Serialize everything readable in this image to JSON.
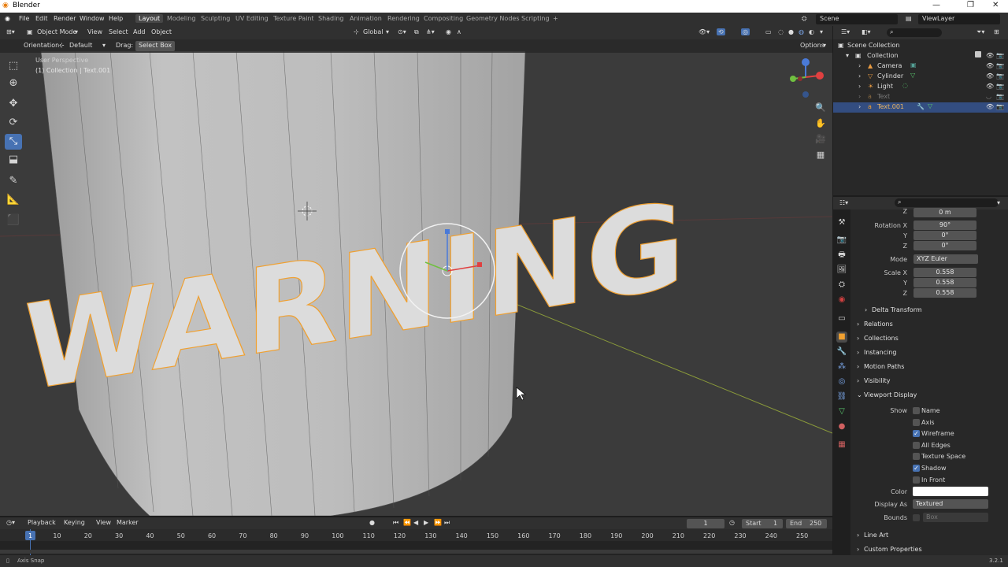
{
  "window": {
    "title": "Blender",
    "min": "—",
    "max": "❐",
    "close": "✕"
  },
  "menus": [
    "File",
    "Edit",
    "Render",
    "Window",
    "Help"
  ],
  "workspaces": [
    "Layout",
    "Modeling",
    "Sculpting",
    "UV Editing",
    "Texture Paint",
    "Shading",
    "Animation",
    "Rendering",
    "Compositing",
    "Geometry Nodes",
    "Scripting",
    "+"
  ],
  "scene": {
    "name": "Scene",
    "view_layer": "ViewLayer"
  },
  "viewport_header": {
    "mode": "Object Mode",
    "view": "View",
    "select": "Select",
    "add": "Add",
    "object": "Object",
    "transform": "Global"
  },
  "tool_settings": {
    "orientation_label": "Orientation:",
    "orientation_value": "Default",
    "drag_label": "Drag:",
    "drag_value": "Select Box",
    "options": "Options"
  },
  "viewport_overlay": {
    "view_name": "User Perspective",
    "collection_info": "(1) Collection | Text.001",
    "warning_text": "WARNING"
  },
  "outliner": {
    "root": "Scene Collection",
    "collection": "Collection",
    "items": [
      "Camera",
      "Cylinder",
      "Light",
      "Text",
      "Text.001"
    ]
  },
  "properties": {
    "top_z": "0 m",
    "rotation_label": "Rotation X",
    "rotation": [
      "90°",
      "0°",
      "0°"
    ],
    "y_label": "Y",
    "z_label": "Z",
    "mode_label": "Mode",
    "mode": "XYZ Euler",
    "scale_label": "Scale X",
    "scale": [
      "0.558",
      "0.558",
      "0.558"
    ],
    "delta": "Delta Transform",
    "sections": [
      "Relations",
      "Collections",
      "Instancing",
      "Motion Paths",
      "Visibility"
    ],
    "viewport_display": "Viewport Display",
    "show_label": "Show",
    "checkboxes": [
      {
        "label": "Name",
        "on": false
      },
      {
        "label": "Axis",
        "on": false
      },
      {
        "label": "Wireframe",
        "on": true
      },
      {
        "label": "All Edges",
        "on": false
      },
      {
        "label": "Texture Space",
        "on": false
      },
      {
        "label": "Shadow",
        "on": true
      },
      {
        "label": "In Front",
        "on": false
      }
    ],
    "color_label": "Color",
    "display_as_label": "Display As",
    "display_as": "Textured",
    "bounds_label": "Bounds",
    "bounds_value": "Box",
    "line_art": "Line Art",
    "custom_props": "Custom Properties"
  },
  "timeline": {
    "playback": "Playback",
    "keying": "Keying",
    "view": "View",
    "marker": "Marker",
    "current_frame": "1",
    "start_label": "Start",
    "start": "1",
    "end_label": "End",
    "end": "250",
    "ticks": [
      "1",
      "10",
      "20",
      "30",
      "40",
      "50",
      "60",
      "70",
      "80",
      "90",
      "100",
      "110",
      "120",
      "130",
      "140",
      "150",
      "160",
      "170",
      "180",
      "190",
      "200",
      "210",
      "220",
      "230",
      "240",
      "250"
    ]
  },
  "status": {
    "left": "Axis Snap",
    "version": "3.2.1"
  },
  "colors": {
    "accent": "#4772b3",
    "selection_orange": "#f0a030",
    "viewport_bg": "#3b3b3b"
  }
}
